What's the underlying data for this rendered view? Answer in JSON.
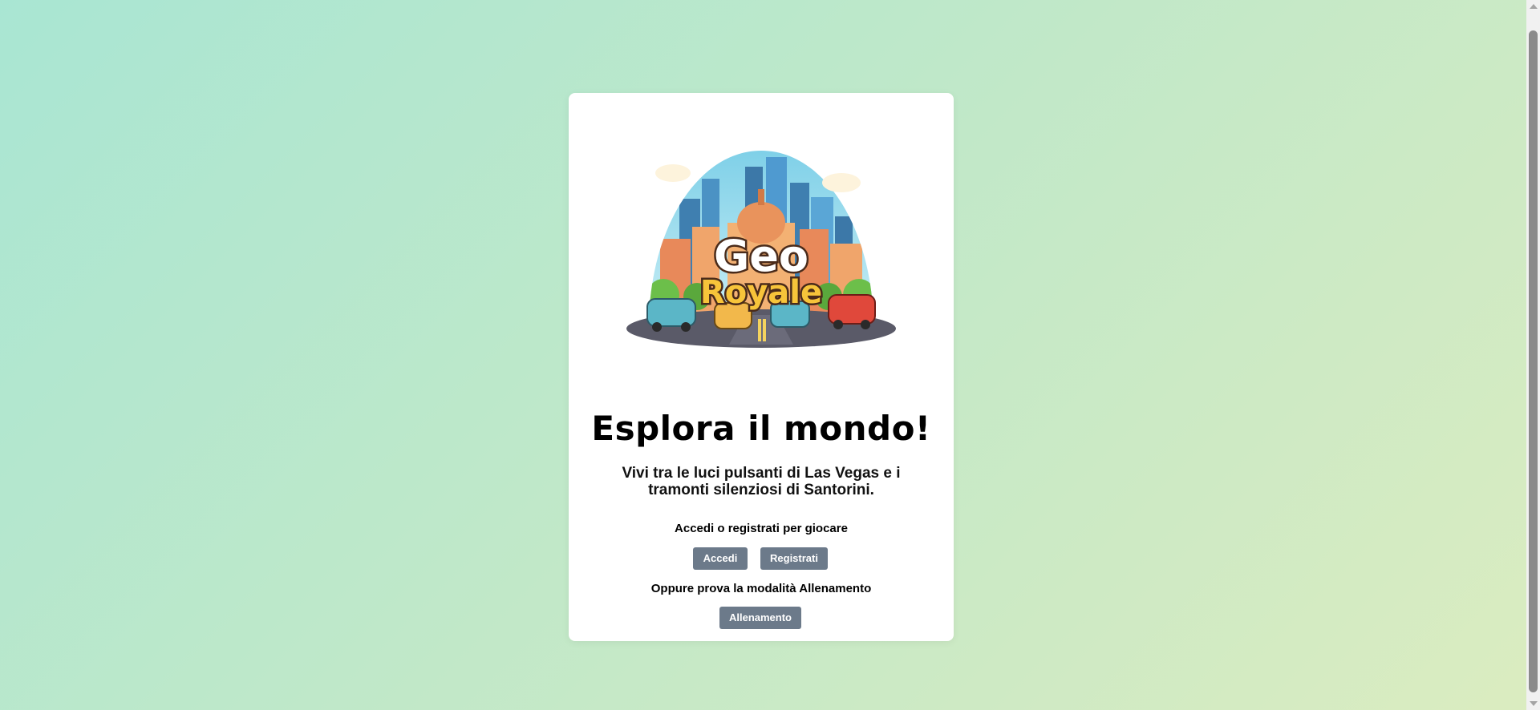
{
  "hero": {
    "logo_line1": "Geo",
    "logo_line2": "Royale",
    "title": "Esplora il mondo!",
    "subtitle": "Vivi tra le luci pulsanti di Las Vegas e i tramonti silenziosi di Santorini."
  },
  "auth": {
    "prompt": "Accedi o registrati per giocare",
    "login_label": "Accedi",
    "register_label": "Registrati"
  },
  "training": {
    "prompt": "Oppure prova la modalità Allenamento",
    "button_label": "Allenamento"
  },
  "colors": {
    "button": "#6c7a8a",
    "background_start": "#a9e6d3",
    "background_end": "#dbecc0"
  }
}
